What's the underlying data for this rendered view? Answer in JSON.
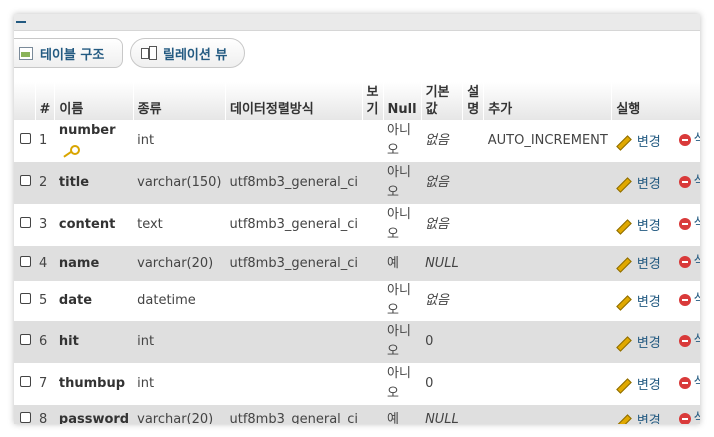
{
  "tabs": [
    {
      "label": "테이블 구조",
      "icon": "table-structure-icon"
    },
    {
      "label": "릴레이션 뷰",
      "icon": "relation-view-icon"
    }
  ],
  "table": {
    "headers": {
      "num": "#",
      "name": "이름",
      "type": "종류",
      "collation": "데이터정렬방식",
      "attributes": "보기",
      "null": "Null",
      "default": "기본값",
      "comments": "설명",
      "extra": "추가",
      "action": "실행"
    },
    "action_labels": {
      "change": "변경",
      "drop": "삭제"
    },
    "rows": [
      {
        "num": "1",
        "name": "number",
        "type": "int",
        "collation": "",
        "null": "아니오",
        "default": "없음",
        "extra": "AUTO_INCREMENT",
        "primary_key": true
      },
      {
        "num": "2",
        "name": "title",
        "type": "varchar(150)",
        "collation": "utf8mb3_general_ci",
        "null": "아니오",
        "default": "없음",
        "extra": ""
      },
      {
        "num": "3",
        "name": "content",
        "type": "text",
        "collation": "utf8mb3_general_ci",
        "null": "아니오",
        "default": "없음",
        "extra": ""
      },
      {
        "num": "4",
        "name": "name",
        "type": "varchar(20)",
        "collation": "utf8mb3_general_ci",
        "null": "예",
        "default": "NULL",
        "extra": ""
      },
      {
        "num": "5",
        "name": "date",
        "type": "datetime",
        "collation": "",
        "null": "아니오",
        "default": "없음",
        "extra": ""
      },
      {
        "num": "6",
        "name": "hit",
        "type": "int",
        "collation": "",
        "null": "아니오",
        "default": "0",
        "extra": ""
      },
      {
        "num": "7",
        "name": "thumbup",
        "type": "int",
        "collation": "",
        "null": "아니오",
        "default": "0",
        "extra": ""
      },
      {
        "num": "8",
        "name": "password",
        "type": "varchar(20)",
        "collation": "utf8mb3_general_ci",
        "null": "예",
        "default": "NULL",
        "extra": ""
      }
    ]
  }
}
